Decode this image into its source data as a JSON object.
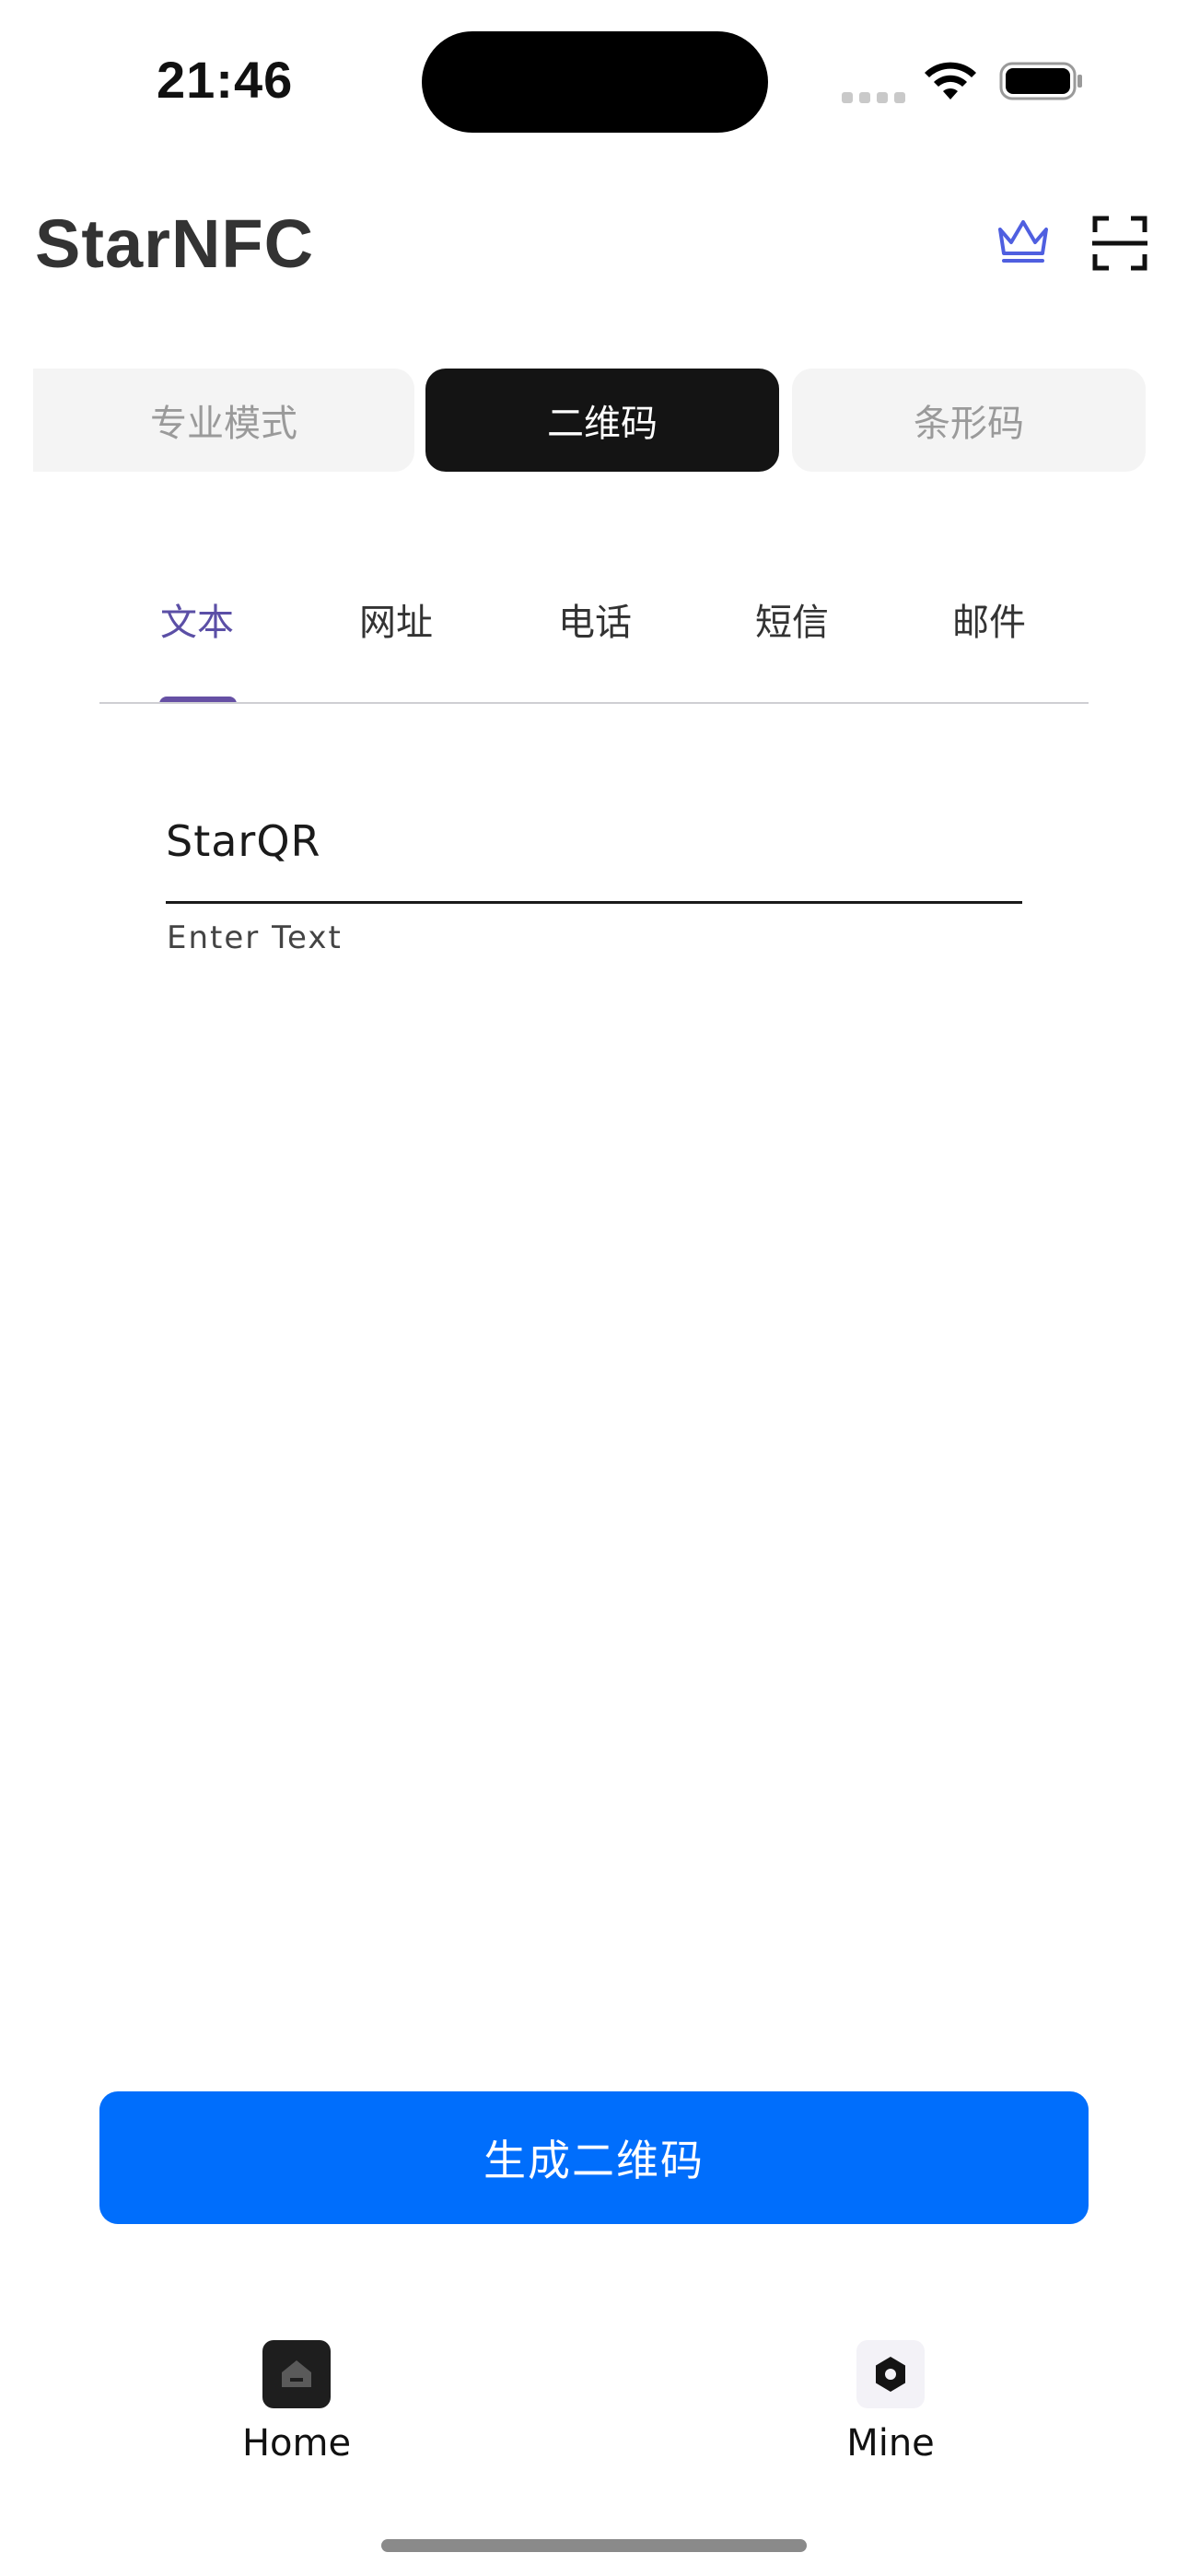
{
  "status_bar": {
    "time": "21:46"
  },
  "header": {
    "title": "StarNFC",
    "crown_color": "#4f5fe0"
  },
  "mode_segments": [
    {
      "label": "专业模式",
      "active": false
    },
    {
      "label": "二维码",
      "active": true
    },
    {
      "label": "条形码",
      "active": false
    }
  ],
  "content_tabs": [
    {
      "label": "文本",
      "active": true
    },
    {
      "label": "网址",
      "active": false
    },
    {
      "label": "电话",
      "active": false
    },
    {
      "label": "短信",
      "active": false
    },
    {
      "label": "邮件",
      "active": false
    }
  ],
  "text_field": {
    "value": "StarQR",
    "helper": "Enter Text"
  },
  "generate_button": {
    "label": "生成二维码",
    "color": "#006efc"
  },
  "bottom_nav": {
    "home_label": "Home",
    "mine_label": "Mine"
  },
  "colors": {
    "accent_tab": "#5b4fa6",
    "segment_active": "#141414"
  }
}
